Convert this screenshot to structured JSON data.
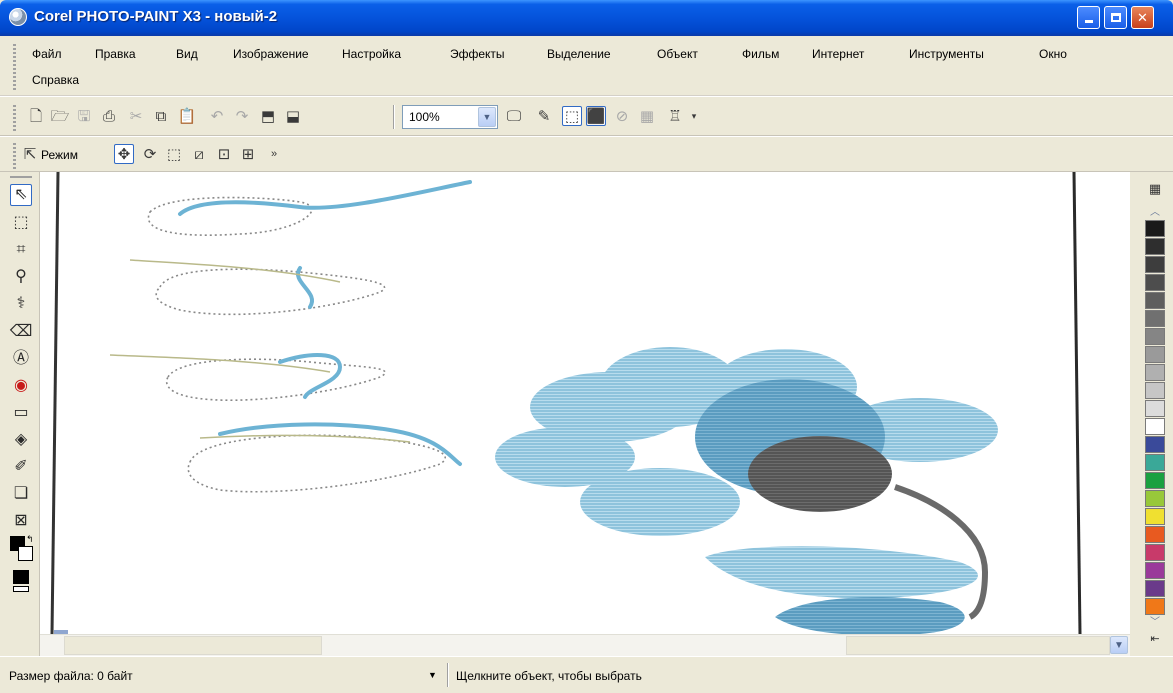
{
  "window": {
    "title": "Corel PHOTO-PAINT X3 - новый-2",
    "controls": {
      "minimize": "minimize",
      "maximize": "maximize",
      "close": "✕"
    }
  },
  "menu": {
    "row1": [
      "Файл",
      "Правка",
      "Вид",
      "Изображение",
      "Настройка",
      "Эффекты",
      "Выделение",
      "Объект",
      "Фильм",
      "Интернет",
      "Инструменты",
      "Окно"
    ],
    "row2": [
      "Справка"
    ]
  },
  "toolbar_standard": {
    "zoom_value": "100%"
  },
  "toolbar_property": {
    "mode_label": "Режим"
  },
  "status": {
    "file_size": "Размер файла: 0 байт",
    "hint": "Щелкните объект, чтобы выбрать"
  },
  "palette": {
    "colors": [
      "#1a1a1a",
      "#2e2e2e",
      "#3d3d3d",
      "#4d4d4d",
      "#5e5e5e",
      "#707070",
      "#858585",
      "#9a9a9a",
      "#b0b0b0",
      "#c6c6c6",
      "#dcdcdc",
      "#ffffff",
      "#3a4a9a",
      "#3aa898",
      "#1aa040",
      "#98c83a",
      "#f0e030",
      "#e85a20",
      "#c83a6a",
      "#9a3a9a",
      "#6a3a8a",
      "#f07818"
    ]
  }
}
